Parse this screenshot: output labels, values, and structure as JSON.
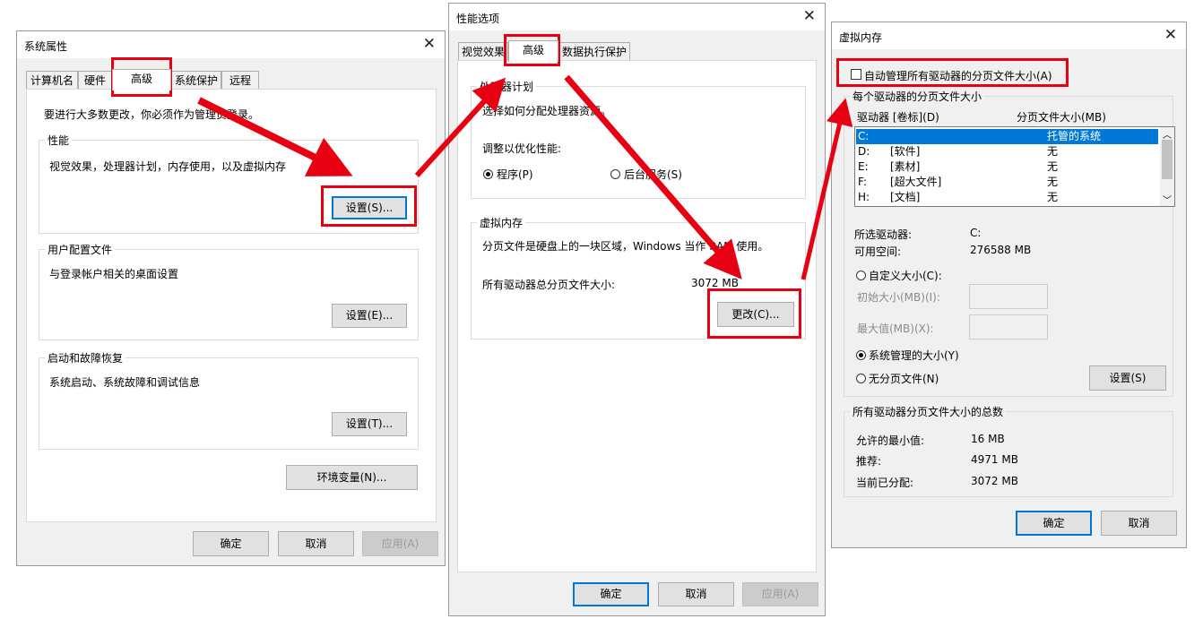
{
  "sys": {
    "title": "系统属性",
    "tabs": [
      "计算机名",
      "硬件",
      "高级",
      "系统保护",
      "远程"
    ],
    "admin_note": "要进行大多数更改，你必须作为管理员登录。",
    "perf": {
      "caption": "性能",
      "desc": "视觉效果，处理器计划，内存使用，以及虚拟内存",
      "button": "设置(S)..."
    },
    "profile": {
      "caption": "用户配置文件",
      "desc": "与登录帐户相关的桌面设置",
      "button": "设置(E)..."
    },
    "startup": {
      "caption": "启动和故障恢复",
      "desc": "系统启动、系统故障和调试信息",
      "button": "设置(T)..."
    },
    "env_button": "环境变量(N)...",
    "ok": "确定",
    "cancel": "取消",
    "apply": "应用(A)"
  },
  "perf": {
    "title": "性能选项",
    "tabs": [
      "视觉效果",
      "高级",
      "数据执行保护"
    ],
    "sched": {
      "caption": "处理器计划",
      "desc": "选择如何分配处理器资源。",
      "adjust": "调整以优化性能:",
      "opt_program": "程序(P)",
      "opt_service": "后台服务(S)"
    },
    "vm": {
      "caption": "虚拟内存",
      "desc": "分页文件是硬盘上的一块区域，Windows 当作 RAM 使用。",
      "total_label": "所有驱动器总分页文件大小:",
      "total_value": "3072 MB",
      "change": "更改(C)..."
    },
    "ok": "确定",
    "cancel": "取消",
    "apply": "应用(A)"
  },
  "vm": {
    "title": "虚拟内存",
    "auto": "自动管理所有驱动器的分页文件大小(A)",
    "each_caption": "每个驱动器的分页文件大小",
    "col_drive": "驱动器 [卷标](D)",
    "col_size": "分页文件大小(MB)",
    "drives": [
      {
        "drive": "C:",
        "label": "",
        "size": "托管的系统"
      },
      {
        "drive": "D:",
        "label": "[软件]",
        "size": "无"
      },
      {
        "drive": "E:",
        "label": "[素材]",
        "size": "无"
      },
      {
        "drive": "F:",
        "label": "[超大文件]",
        "size": "无"
      },
      {
        "drive": "H:",
        "label": "[文档]",
        "size": "无"
      }
    ],
    "selected_label": "所选驱动器:",
    "selected_value": "C:",
    "free_label": "可用空间:",
    "free_value": "276588 MB",
    "custom": "自定义大小(C):",
    "initial": "初始大小(MB)(I):",
    "max": "最大值(MB)(X):",
    "system_managed": "系统管理的大小(Y)",
    "no_paging": "无分页文件(N)",
    "set": "设置(S)",
    "total_caption": "所有驱动器分页文件大小的总数",
    "min_label": "允许的最小值:",
    "min_value": "16 MB",
    "rec_label": "推荐:",
    "rec_value": "4971 MB",
    "cur_label": "当前已分配:",
    "cur_value": "3072 MB",
    "ok": "确定",
    "cancel": "取消"
  },
  "accent": "#0078d7",
  "highlight": "#e60012"
}
